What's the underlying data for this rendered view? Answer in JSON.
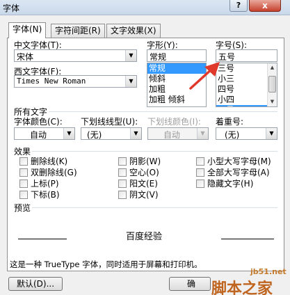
{
  "window": {
    "title": "字体",
    "help_label": "?",
    "close_label": "x"
  },
  "tabs": [
    {
      "label": "字体(N)",
      "active": true
    },
    {
      "label": "字符间距(R)",
      "active": false
    },
    {
      "label": "文字效果(X)",
      "active": false
    }
  ],
  "font": {
    "chinese_label": "中文字体(T):",
    "chinese_value": "宋体",
    "western_label": "西文字体(F):",
    "western_value": "Times New Roman"
  },
  "style": {
    "label": "字形(Y):",
    "value": "常规",
    "items": [
      "常规",
      "倾斜",
      "加粗",
      "加粗 倾斜"
    ],
    "selected_index": 0
  },
  "size": {
    "label": "字号(S):",
    "value": "五号",
    "items": [
      "三号",
      "小三",
      "四号",
      "小四",
      "五号"
    ],
    "selected_index": 4
  },
  "all_text": {
    "section_label": "所有文字",
    "color_label": "字体颜色(C):",
    "color_value": "自动",
    "underline_label": "下划线线型(U):",
    "underline_value": "(无)",
    "underline_color_label": "下划线颜色(I):",
    "underline_color_value": "自动",
    "emphasis_label": "着重号:",
    "emphasis_value": "(无)"
  },
  "effects": {
    "section_label": "效果",
    "col1": [
      "删除线(K)",
      "双删除线(G)",
      "上标(P)",
      "下标(B)"
    ],
    "col2": [
      "阴影(W)",
      "空心(O)",
      "阳文(E)",
      "阴文(V)"
    ],
    "col3": [
      "小型大写字母(M)",
      "全部大写字母(A)",
      "隐藏文字(H)"
    ]
  },
  "preview": {
    "section_label": "预览",
    "sample_text": "百度经验",
    "description": "这是一种 TrueType 字体，同时适用于屏幕和打印机。"
  },
  "buttons": {
    "default_label": "默认(D)...",
    "ok_label": "确"
  },
  "watermark": {
    "site": "jb51.net",
    "brand": "脚本之家"
  },
  "colors": {
    "selection": "#3399ff",
    "annotation_arrow": "#e0392b"
  }
}
